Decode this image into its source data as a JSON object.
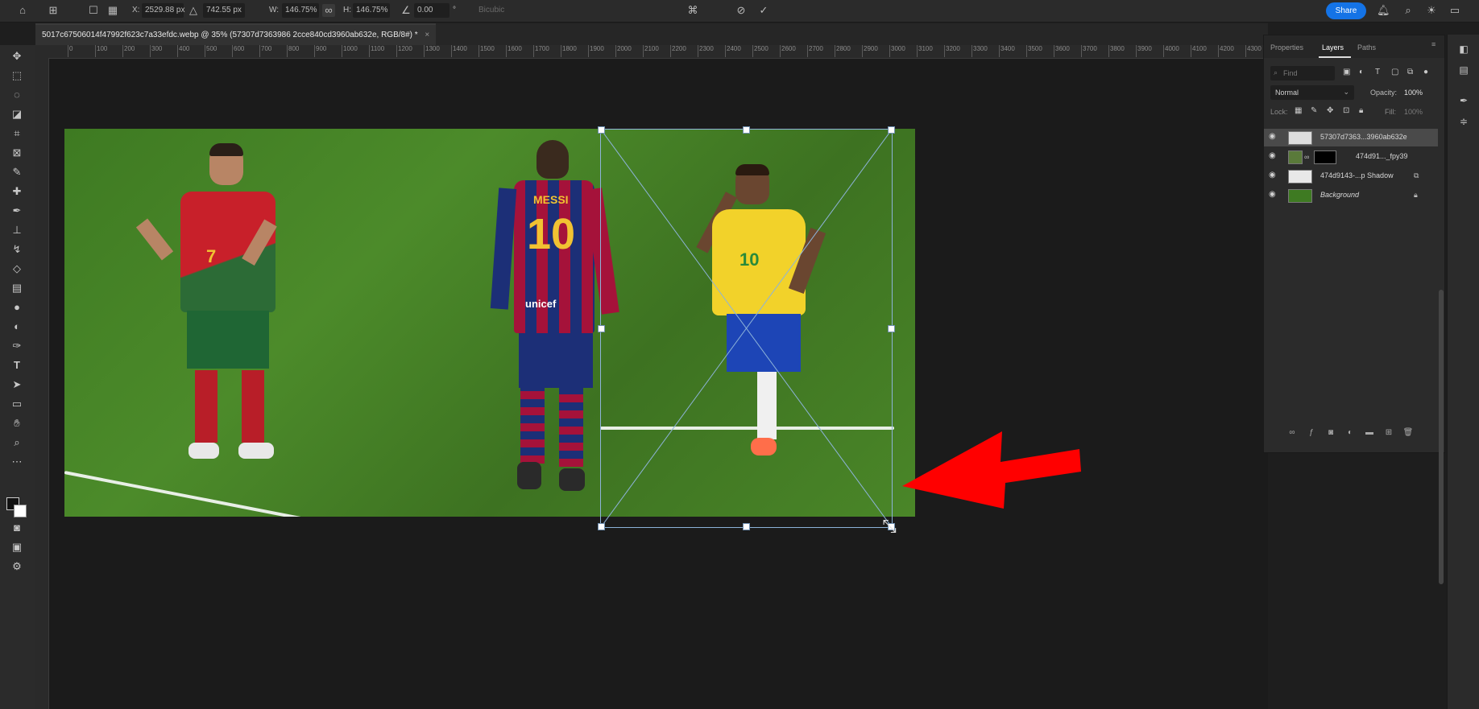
{
  "options_bar": {
    "x_label": "X:",
    "x_value": "2529.88 px",
    "y_value": "742.55 px",
    "w_label": "W:",
    "w_value": "146.75%",
    "h_label": "H:",
    "h_value": "146.75%",
    "angle_value": "0.00",
    "interp_label": "Bicubic",
    "share_label": "Share"
  },
  "document": {
    "tab_title": "5017c67506014f47992f623c7a33efdc.webp @ 35% (57307d7363986 2cce840cd3960ab632e, RGB/8#) *"
  },
  "ruler_ticks": [
    "0",
    "100",
    "200",
    "300",
    "400",
    "500",
    "600",
    "700",
    "800",
    "900",
    "1000",
    "1100",
    "1200",
    "1300",
    "1400",
    "1500",
    "1600",
    "1700",
    "1800",
    "1900",
    "2000",
    "2100",
    "2200",
    "2300",
    "2400",
    "2500",
    "2600",
    "2700",
    "2800",
    "2900",
    "3000",
    "3100",
    "3200",
    "3300",
    "3400",
    "3500",
    "3600",
    "3700",
    "3800",
    "3900",
    "4000",
    "4100",
    "4200",
    "4300"
  ],
  "canvas_image": {
    "player_left_number": "7",
    "player_middle_name": "MESSI",
    "player_middle_number": "10",
    "player_middle_sponsor": "unicef",
    "player_right_number": "10"
  },
  "panels": {
    "tabs": [
      "Properties",
      "Layers",
      "Paths"
    ],
    "active_tab": "Layers",
    "search_placeholder": "Find",
    "blend_mode": "Normal",
    "opacity_label": "Opacity:",
    "opacity_value": "100%",
    "lock_label": "Lock:",
    "fill_label": "Fill:",
    "fill_value": "100%",
    "layers": [
      {
        "name": "57307d7363...3960ab632e",
        "selected": true
      },
      {
        "name": "474d91..._fpy39",
        "selected": false
      },
      {
        "name": "474d9143-...p Shadow",
        "selected": false
      },
      {
        "name": "Background",
        "selected": false
      }
    ]
  },
  "colors": {
    "accent": "#1473e6",
    "transform_box": "#8db3d9",
    "arrow": "#ff0000"
  }
}
